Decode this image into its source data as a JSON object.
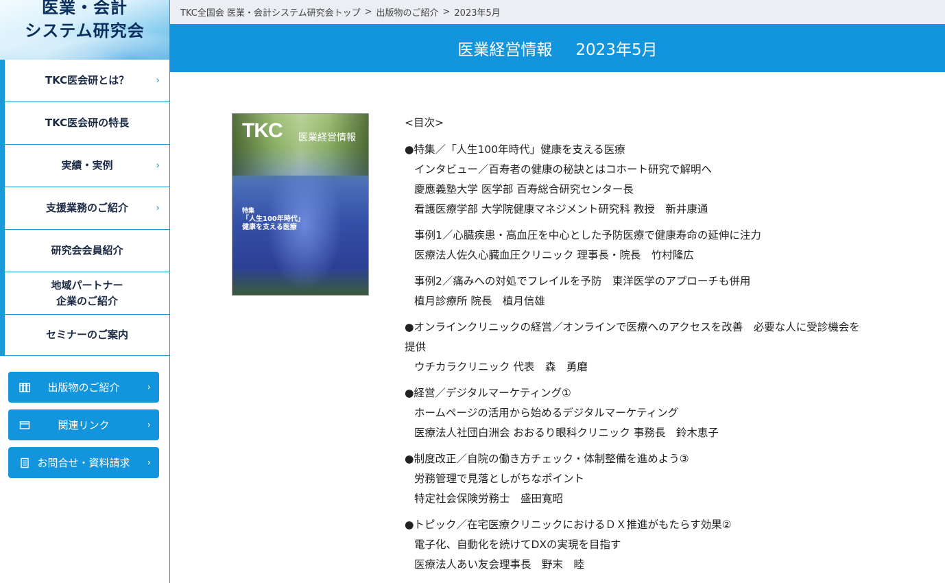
{
  "logo": {
    "line1": "医業・会計",
    "line2": "システム研究会"
  },
  "sidebar": {
    "items": [
      {
        "label": "TKC医会研とは？",
        "chevron": "›"
      },
      {
        "label": "TKC医会研の特長",
        "chevron": ""
      },
      {
        "label": "実績・実例",
        "chevron": "›"
      },
      {
        "label": "支援業務のご紹介",
        "chevron": "›"
      },
      {
        "label": "研究会会員紹介",
        "chevron": ""
      },
      {
        "label_line1": "地域パートナー",
        "label_line2": "企業のご紹介",
        "chevron": ""
      },
      {
        "label": "セミナーのご案内",
        "chevron": ""
      }
    ],
    "buttons": [
      {
        "label": "出版物のご紹介",
        "icon": "books-icon",
        "chevron": "›"
      },
      {
        "label": "関連リンク",
        "icon": "window-icon",
        "chevron": "›"
      },
      {
        "label": "お問合せ・資料請求",
        "icon": "document-icon",
        "chevron": "›"
      }
    ]
  },
  "breadcrumb": {
    "items": [
      "TKC全国会 医業・会計システム研究会トップ",
      "出版物のご紹介",
      "2023年5月"
    ],
    "separator": ">"
  },
  "title": {
    "main": "医業経営情報",
    "date": "2023年5月"
  },
  "cover": {
    "logo": "TKC",
    "magazine": "医業経営情報",
    "feature_label": "特集",
    "feature_title_1": "「人生100年時代」",
    "feature_title_2": "健康を支える医療"
  },
  "toc": {
    "heading": "<目次>",
    "sections": [
      {
        "title": "●特集／「人生100年時代」健康を支える医療",
        "groups": [
          [
            "インタビュー／百寿者の健康の秘訣とはコホート研究で解明へ",
            "慶應義塾大学 医学部 百寿総合研究センター長",
            "看護医療学部 大学院健康マネジメント研究科 教授　新井康通"
          ],
          [
            "事例1／心臓疾患・高血圧を中心とした予防医療で健康寿命の延伸に注力",
            "医療法人佐久心臓血圧クリニック 理事長・院長　竹村隆広"
          ],
          [
            "事例2／痛みへの対処でフレイルを予防　東洋医学のアプローチも併用",
            "植月診療所 院長　植月信雄"
          ]
        ]
      },
      {
        "title": "●オンラインクリニックの経営／オンラインで医療へのアクセスを改善　必要な人に受診機会を",
        "title_wrap": "提供",
        "groups": [
          [
            "ウチカラクリニック 代表　森　勇磨"
          ]
        ]
      },
      {
        "title": "●経営／デジタルマーケティング①",
        "groups": [
          [
            "ホームページの活用から始めるデジタルマーケティング",
            "医療法人社団白洲会 おおるり眼科クリニック 事務長　鈴木恵子"
          ]
        ]
      },
      {
        "title": "●制度改正／自院の働き方チェック・体制整備を進めよう③",
        "groups": [
          [
            "労務管理で見落としがちなポイント",
            "特定社会保険労務士　盛田寛昭"
          ]
        ]
      },
      {
        "title": "●トピック／在宅医療クリニックにおけるＤＸ推進がもたらす効果②",
        "groups": [
          [
            "電子化、自動化を続けてDXの実現を目指す",
            "医療法人あい友会理事長　野末　睦"
          ]
        ]
      }
    ]
  },
  "colors": {
    "accent": "#1295dc",
    "nav_border": "#1a9ad6",
    "breadcrumb_bg": "#eceef3"
  }
}
